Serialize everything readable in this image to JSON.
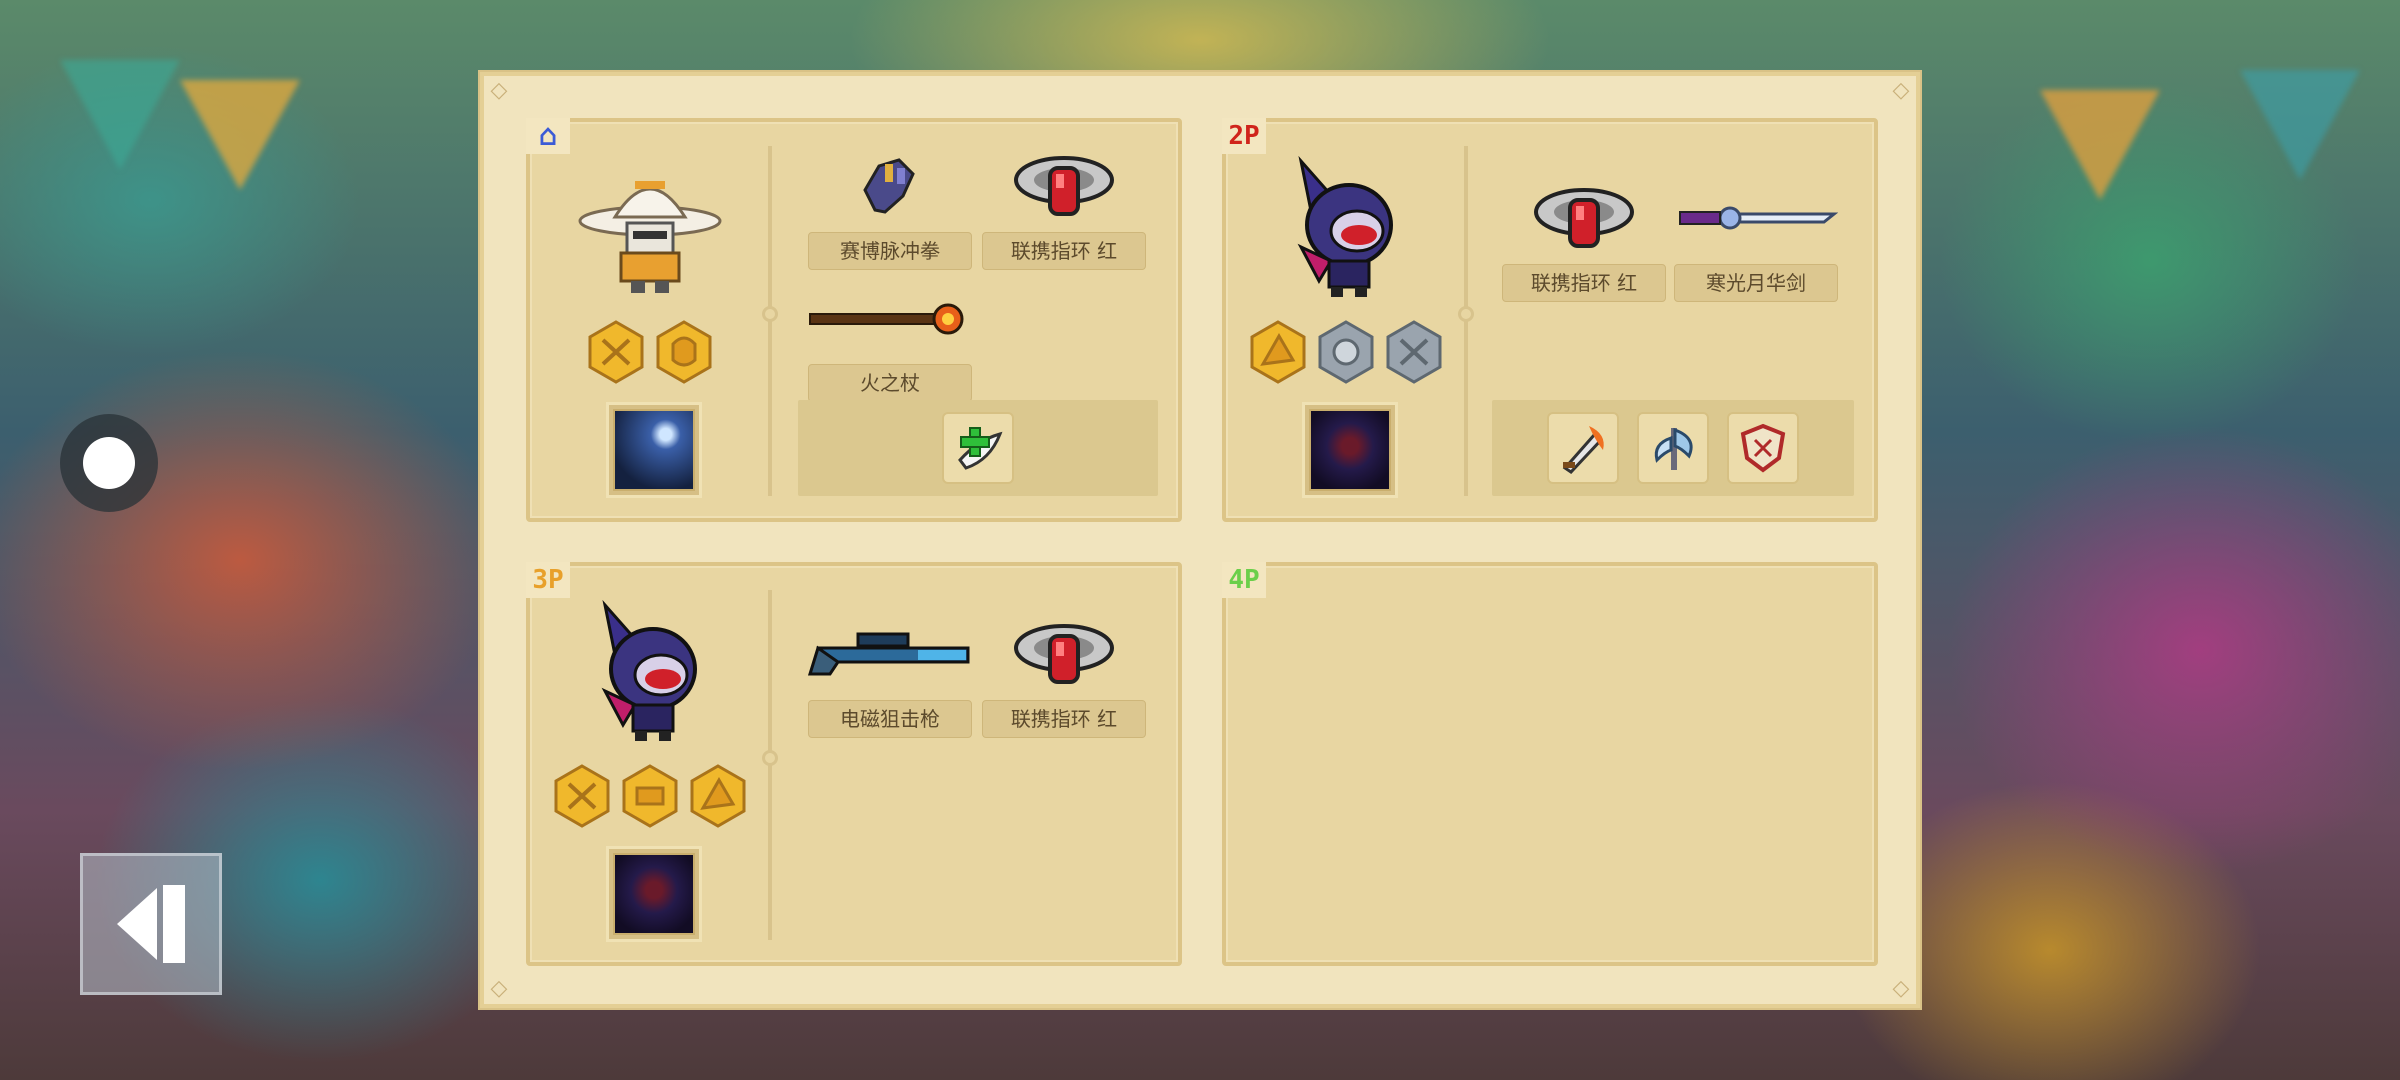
{
  "players": [
    {
      "badge": "⌂",
      "hero": "knight-paladin",
      "buffs": [
        "buff-icon",
        "buff-icon"
      ],
      "skill": "lightning-skill-icon",
      "items": [
        {
          "label": "赛博脉冲拳",
          "icon": "cyber-fist-icon"
        },
        {
          "label": "联携指环 红",
          "icon": "red-ring-icon"
        },
        {
          "label": "火之杖",
          "icon": "fire-staff-icon"
        }
      ],
      "tray": [
        "heal-plus-icon"
      ]
    },
    {
      "badge": "2P",
      "hero": "shadow-assassin",
      "buffs": [
        "buff-icon",
        "buff-icon",
        "buff-icon"
      ],
      "skill": "shadow-skill-icon",
      "items": [
        {
          "label": "联携指环 红",
          "icon": "red-ring-icon"
        },
        {
          "label": "寒光月华剑",
          "icon": "moon-sword-icon"
        }
      ],
      "tray": [
        "flame-sword-icon",
        "frost-axe-icon",
        "shield-icon"
      ]
    },
    {
      "badge": "3P",
      "hero": "shadow-assassin",
      "buffs": [
        "buff-icon",
        "buff-icon",
        "buff-icon"
      ],
      "skill": "shadow-skill-icon",
      "items": [
        {
          "label": "电磁狙击枪",
          "icon": "sniper-rifle-icon"
        },
        {
          "label": "联携指环 红",
          "icon": "red-ring-icon"
        }
      ]
    },
    {
      "badge": "4P"
    }
  ]
}
